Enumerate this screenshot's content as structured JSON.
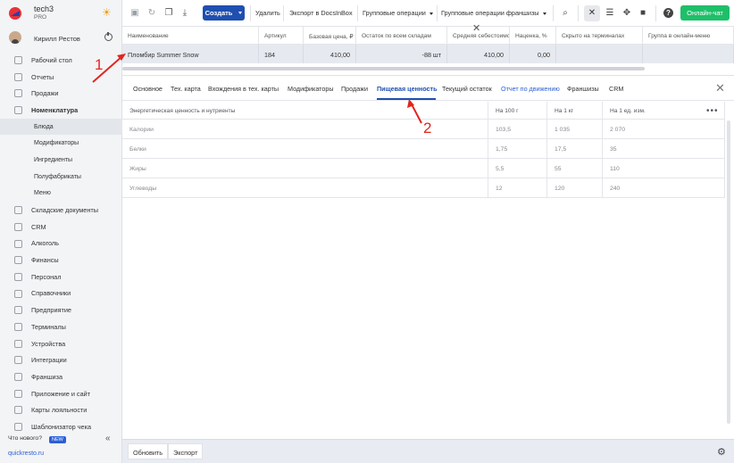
{
  "brand": {
    "name": "tech3",
    "plan": "PRO"
  },
  "user": {
    "name": "Кирилл Рестов"
  },
  "sidebar": {
    "items": [
      {
        "label": "Рабочий стол",
        "sub": false
      },
      {
        "label": "Отчеты",
        "sub": false
      },
      {
        "label": "Продажи",
        "sub": false
      },
      {
        "label": "Номенклатура",
        "sub": false,
        "bold": true
      },
      {
        "label": "Блюда",
        "sub": true,
        "active": true
      },
      {
        "label": "Модификаторы",
        "sub": true
      },
      {
        "label": "Ингредиенты",
        "sub": true
      },
      {
        "label": "Полуфабрикаты",
        "sub": true
      },
      {
        "label": "Меню",
        "sub": true
      },
      {
        "label": "Складские документы",
        "sub": false
      },
      {
        "label": "CRM",
        "sub": false
      },
      {
        "label": "Алкоголь",
        "sub": false
      },
      {
        "label": "Финансы",
        "sub": false
      },
      {
        "label": "Персонал",
        "sub": false
      },
      {
        "label": "Справочники",
        "sub": false
      },
      {
        "label": "Предприятие",
        "sub": false
      },
      {
        "label": "Терминалы",
        "sub": false
      },
      {
        "label": "Устройства",
        "sub": false
      },
      {
        "label": "Интеграции",
        "sub": false
      },
      {
        "label": "Франшиза",
        "sub": false
      },
      {
        "label": "Приложение и сайт",
        "sub": false
      },
      {
        "label": "Карты лояльности",
        "sub": false
      },
      {
        "label": "Шаблонизатор чека",
        "sub": false
      }
    ],
    "whats_new": "Что нового?",
    "new_badge": "NEW",
    "footer_link": "quickresto.ru"
  },
  "toolbar": {
    "create": "Создать",
    "delete": "Удалить",
    "export_docsinbox": "Экспорт в DocsInBox",
    "group_ops": "Групповые операции",
    "group_ops_franchise": "Групповые операции франшизы",
    "chat": "Онлайн-чат"
  },
  "grid": {
    "headers": [
      "Наименование",
      "Артикул",
      "Базовая цена, ₽",
      "Остаток по всем складам",
      "Средняя себестоимость",
      "Наценка, %",
      "Скрыто на терминалах",
      "Группа в онлайн-меню"
    ],
    "row": [
      "Пломбир Summer Snow",
      "184",
      "410,00",
      "-88 шт",
      "410,00",
      "0,00",
      "",
      ""
    ]
  },
  "tabs": [
    {
      "label": "Основное"
    },
    {
      "label": "Тех. карта"
    },
    {
      "label": "Вхождения в тех. карты"
    },
    {
      "label": "Модификаторы"
    },
    {
      "label": "Продажи"
    },
    {
      "label": "Пищевая ценность",
      "active": true
    },
    {
      "label": "Текущий остаток"
    },
    {
      "label": "Отчет по движению",
      "link": true
    },
    {
      "label": "Франшизы"
    },
    {
      "label": "CRM"
    }
  ],
  "nutrition": {
    "headers": [
      "Энергетическая ценность и нутриенты",
      "На 100 г",
      "На 1 кг",
      "На 1 ед. изм."
    ],
    "rows": [
      [
        "Калории",
        "103,5",
        "1 035",
        "2 070"
      ],
      [
        "Белки",
        "1,75",
        "17,5",
        "35"
      ],
      [
        "Жиры",
        "5,5",
        "55",
        "110"
      ],
      [
        "Углеводы",
        "12",
        "120",
        "240"
      ]
    ]
  },
  "bottom": {
    "refresh": "Обновить",
    "export": "Экспорт"
  },
  "annotations": {
    "one": "1",
    "two": "2"
  },
  "colors": {
    "accent": "#1f4fb0",
    "chat": "#1fbf6a",
    "annotation": "#e0261f"
  }
}
